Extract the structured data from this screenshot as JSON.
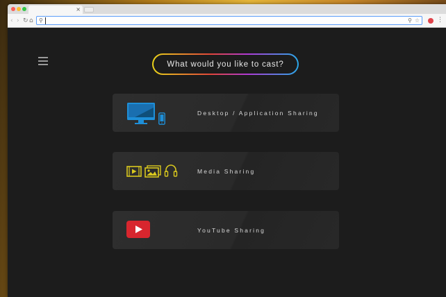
{
  "browser": {
    "tab_close": "×",
    "address_value": "",
    "nav_back": "‹",
    "nav_forward": "›",
    "nav_reload": "↻",
    "nav_home": "⌂",
    "search_glyph": "⚲",
    "zoom_glyph": "⚲",
    "star_glyph": "☆",
    "menu_glyph": "⋮"
  },
  "page": {
    "prompt": "What would you like to cast?",
    "options": [
      {
        "label": "Desktop / Application Sharing",
        "icons": [
          "monitor-icon",
          "phone-icon"
        ],
        "color": "#1e8fd8"
      },
      {
        "label": "Media Sharing",
        "icons": [
          "video-icon",
          "image-icon",
          "headphones-icon"
        ],
        "color": "#d9c81e"
      },
      {
        "label": "YouTube Sharing",
        "icons": [
          "youtube-icon"
        ],
        "color": "#d8262e"
      }
    ]
  },
  "colors": {
    "page_background": "#1c1c1c",
    "card_background": "#2a2a2a",
    "text": "#d8d8d8"
  }
}
